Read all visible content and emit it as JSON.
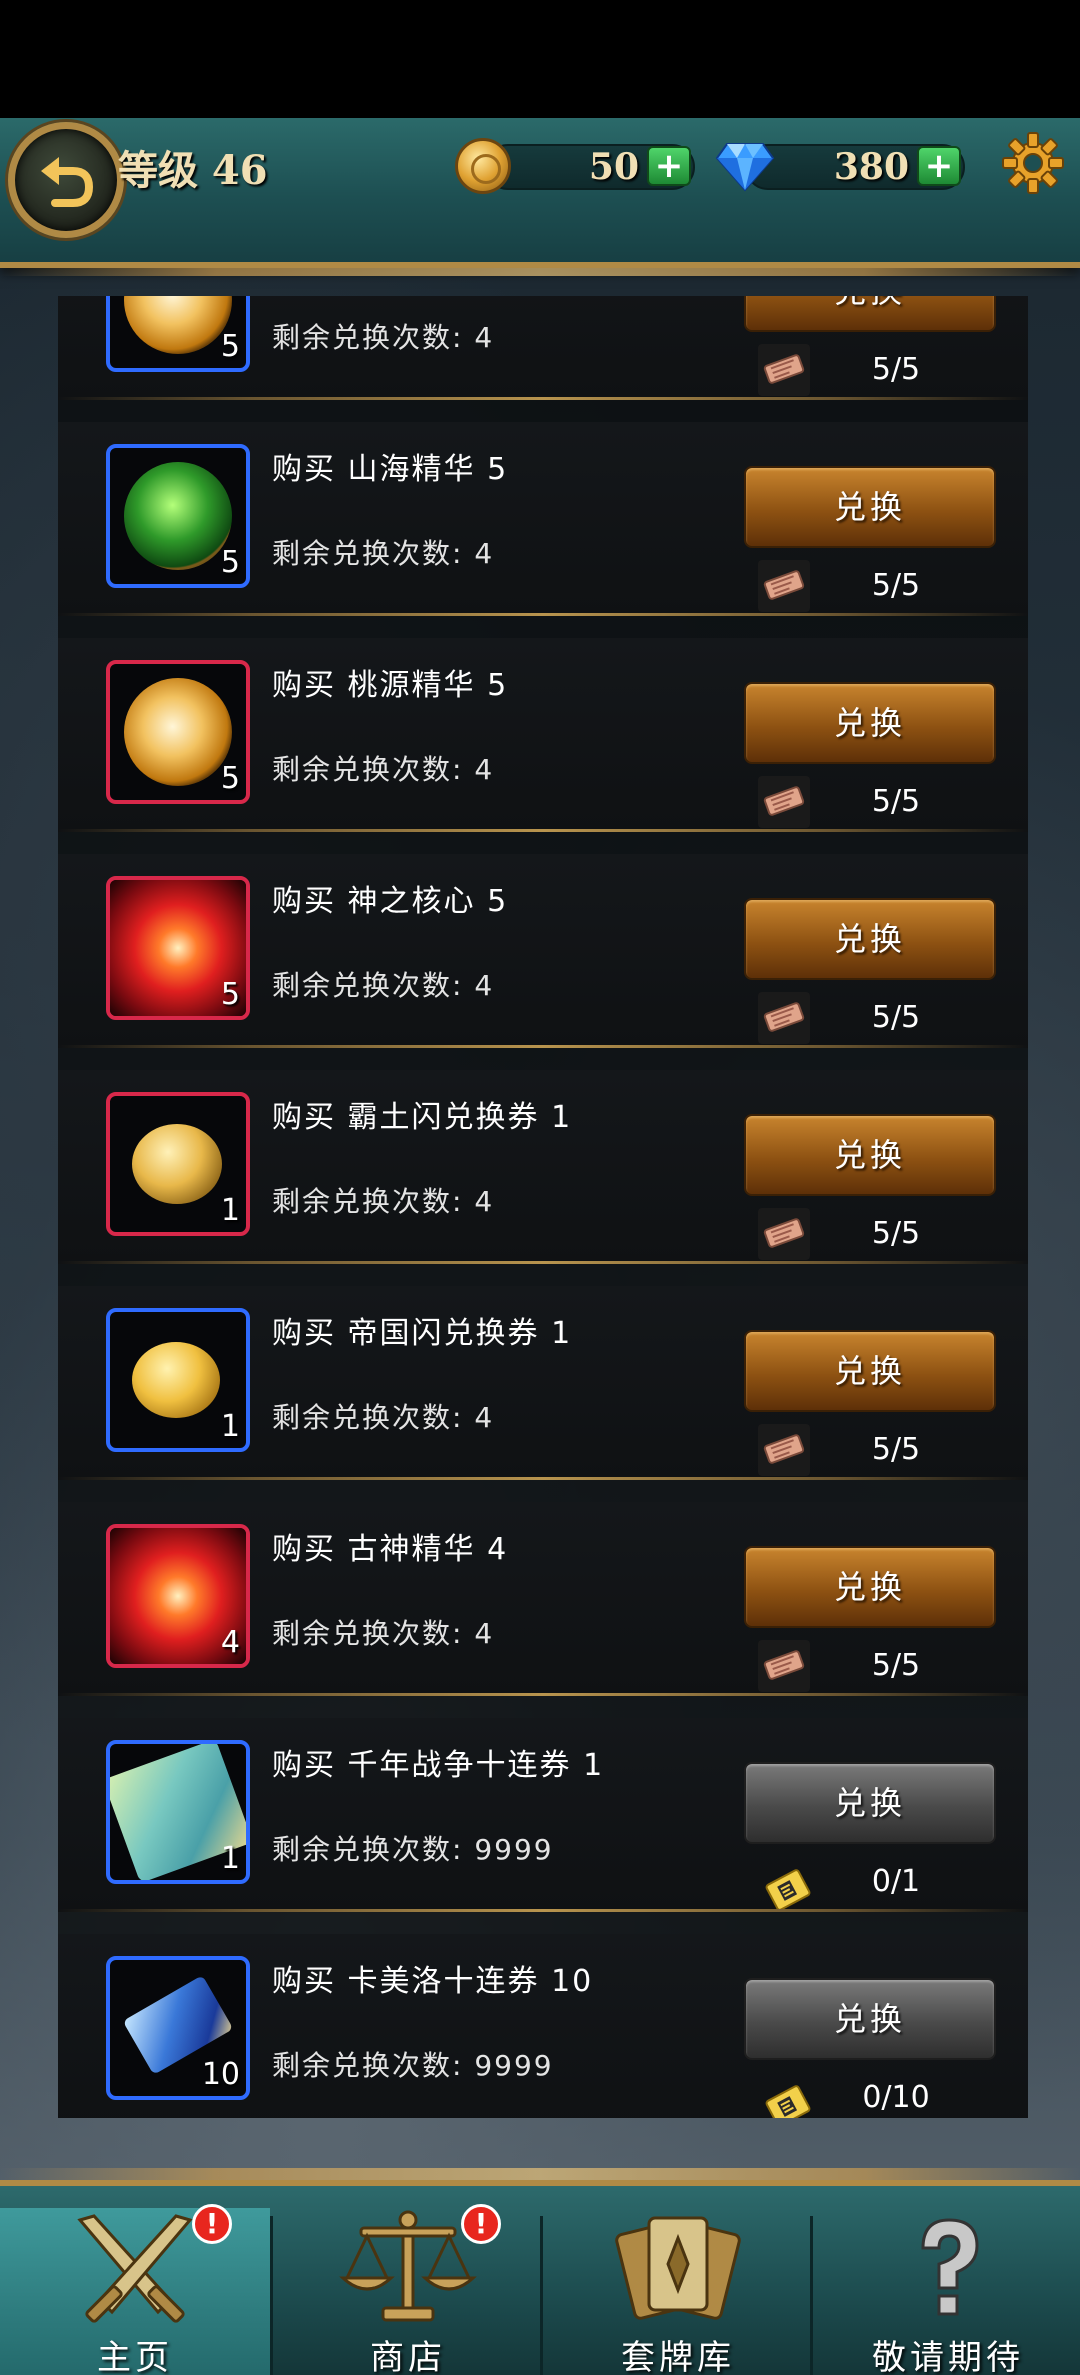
{
  "header": {
    "level_label": "等级 46",
    "coins": "50",
    "gems": "380",
    "plus": "+"
  },
  "items": [
    {
      "title": "",
      "qty": "5",
      "remain": "剩余兑换次数: 4",
      "button": "兑换",
      "cost": "5/5",
      "frame": "blue",
      "art": "peach",
      "cost_type": "token",
      "enabled": true,
      "partial": true
    },
    {
      "title": "购买 山海精华 5",
      "qty": "5",
      "remain": "剩余兑换次数: 4",
      "button": "兑换",
      "cost": "5/5",
      "frame": "blue",
      "art": "green",
      "cost_type": "token",
      "enabled": true
    },
    {
      "title": "购买 桃源精华 5",
      "qty": "5",
      "remain": "剩余兑换次数: 4",
      "button": "兑换",
      "cost": "5/5",
      "frame": "red",
      "art": "peach",
      "cost_type": "token",
      "enabled": true
    },
    {
      "title": "购买 神之核心 5",
      "qty": "5",
      "remain": "剩余兑换次数: 4",
      "button": "兑换",
      "cost": "5/5",
      "frame": "red",
      "art": "red",
      "cost_type": "token",
      "enabled": true
    },
    {
      "title": "购买 霸土闪兑换券 1",
      "qty": "1",
      "remain": "剩余兑换次数: 4",
      "button": "兑换",
      "cost": "5/5",
      "frame": "red",
      "art": "coin1",
      "cost_type": "token",
      "enabled": true
    },
    {
      "title": "购买 帝国闪兑换券 1",
      "qty": "1",
      "remain": "剩余兑换次数: 4",
      "button": "兑换",
      "cost": "5/5",
      "frame": "blue",
      "art": "coin2",
      "cost_type": "token",
      "enabled": true
    },
    {
      "title": "购买 古神精华 4",
      "qty": "4",
      "remain": "剩余兑换次数: 4",
      "button": "兑换",
      "cost": "5/5",
      "frame": "red",
      "art": "red",
      "cost_type": "token",
      "enabled": true
    },
    {
      "title": "购买 千年战争十连券 1",
      "qty": "1",
      "remain": "剩余兑换次数: 9999",
      "button": "兑换",
      "cost": "0/1",
      "frame": "blue",
      "art": "ticket",
      "cost_type": "ticket",
      "enabled": false
    },
    {
      "title": "购买 卡美洛十连券 10",
      "qty": "10",
      "remain": "剩余兑换次数: 9999",
      "button": "兑换",
      "cost": "0/10",
      "frame": "blue",
      "art": "ticket2",
      "cost_type": "ticket",
      "enabled": false
    }
  ],
  "nav": [
    {
      "label": "主页",
      "icon": "crossed-swords-icon",
      "badge": "!",
      "active": true
    },
    {
      "label": "商店",
      "icon": "scales-icon",
      "badge": "!",
      "active": false
    },
    {
      "label": "套牌库",
      "icon": "cards-icon",
      "badge": "",
      "active": false
    },
    {
      "label": "敬请期待",
      "icon": "question-icon",
      "badge": "",
      "active": false
    }
  ],
  "colors": {
    "accent_gold": "#b08a45",
    "header_teal": "#1d4f52",
    "button_orange": "#8e5212",
    "frame_blue": "#2f6bff",
    "frame_red": "#d8284a",
    "badge_red": "#e8261e"
  }
}
